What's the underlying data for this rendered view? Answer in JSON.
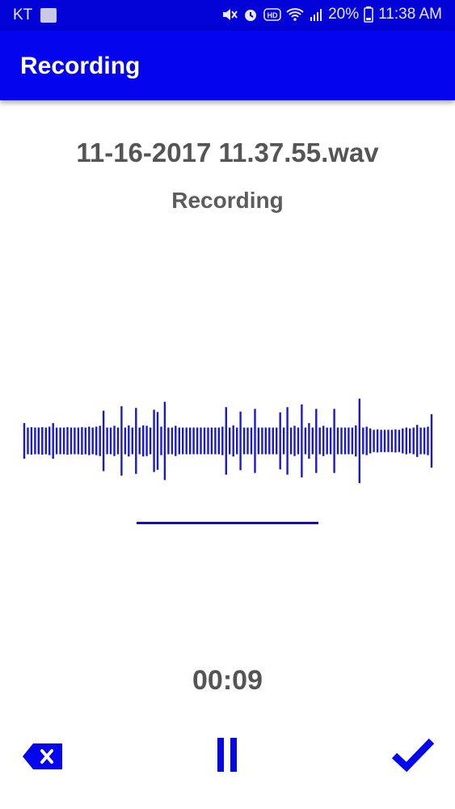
{
  "status_bar": {
    "carrier": "KT",
    "battery": "20%",
    "time": "11:38 AM",
    "icons": [
      "gallery-thumbnail-icon",
      "mute-icon",
      "alarm-icon",
      "hd-icon",
      "wifi-icon",
      "signal-icon",
      "battery-icon"
    ]
  },
  "app_bar": {
    "title": "Recording"
  },
  "recording": {
    "file_name": "11-16-2017 11.37.55.wav",
    "state": "Recording",
    "elapsed": "00:09"
  },
  "waveform": {
    "amplitudes": [
      0.4,
      0.3,
      0.31,
      0.3,
      0.3,
      0.31,
      0.3,
      0.32,
      0.4,
      0.3,
      0.3,
      0.3,
      0.31,
      0.3,
      0.3,
      0.3,
      0.31,
      0.3,
      0.32,
      0.3,
      0.32,
      0.34,
      0.68,
      0.3,
      0.3,
      0.34,
      0.3,
      0.78,
      0.3,
      0.35,
      0.3,
      0.74,
      0.3,
      0.35,
      0.34,
      0.3,
      0.7,
      0.65,
      0.32,
      0.88,
      0.3,
      0.3,
      0.34,
      0.3,
      0.3,
      0.3,
      0.3,
      0.3,
      0.3,
      0.3,
      0.3,
      0.3,
      0.3,
      0.3,
      0.3,
      0.32,
      0.76,
      0.3,
      0.35,
      0.3,
      0.66,
      0.3,
      0.3,
      0.3,
      0.72,
      0.3,
      0.3,
      0.3,
      0.3,
      0.3,
      0.3,
      0.64,
      0.3,
      0.76,
      0.3,
      0.34,
      0.3,
      0.82,
      0.3,
      0.4,
      0.3,
      0.72,
      0.3,
      0.34,
      0.3,
      0.3,
      0.72,
      0.3,
      0.3,
      0.3,
      0.3,
      0.3,
      0.35,
      0.95,
      0.3,
      0.32,
      0.28,
      0.25,
      0.26,
      0.25,
      0.25,
      0.25,
      0.25,
      0.26,
      0.25,
      0.28,
      0.3,
      0.28,
      0.3,
      0.36,
      0.3,
      0.3,
      0.32,
      0.6
    ],
    "color": "#1a1ac8"
  },
  "controls": {
    "delete_icon": "backspace-delete-icon",
    "pause_icon": "pause-icon",
    "done_icon": "checkmark-icon",
    "color": "#0505ee"
  }
}
